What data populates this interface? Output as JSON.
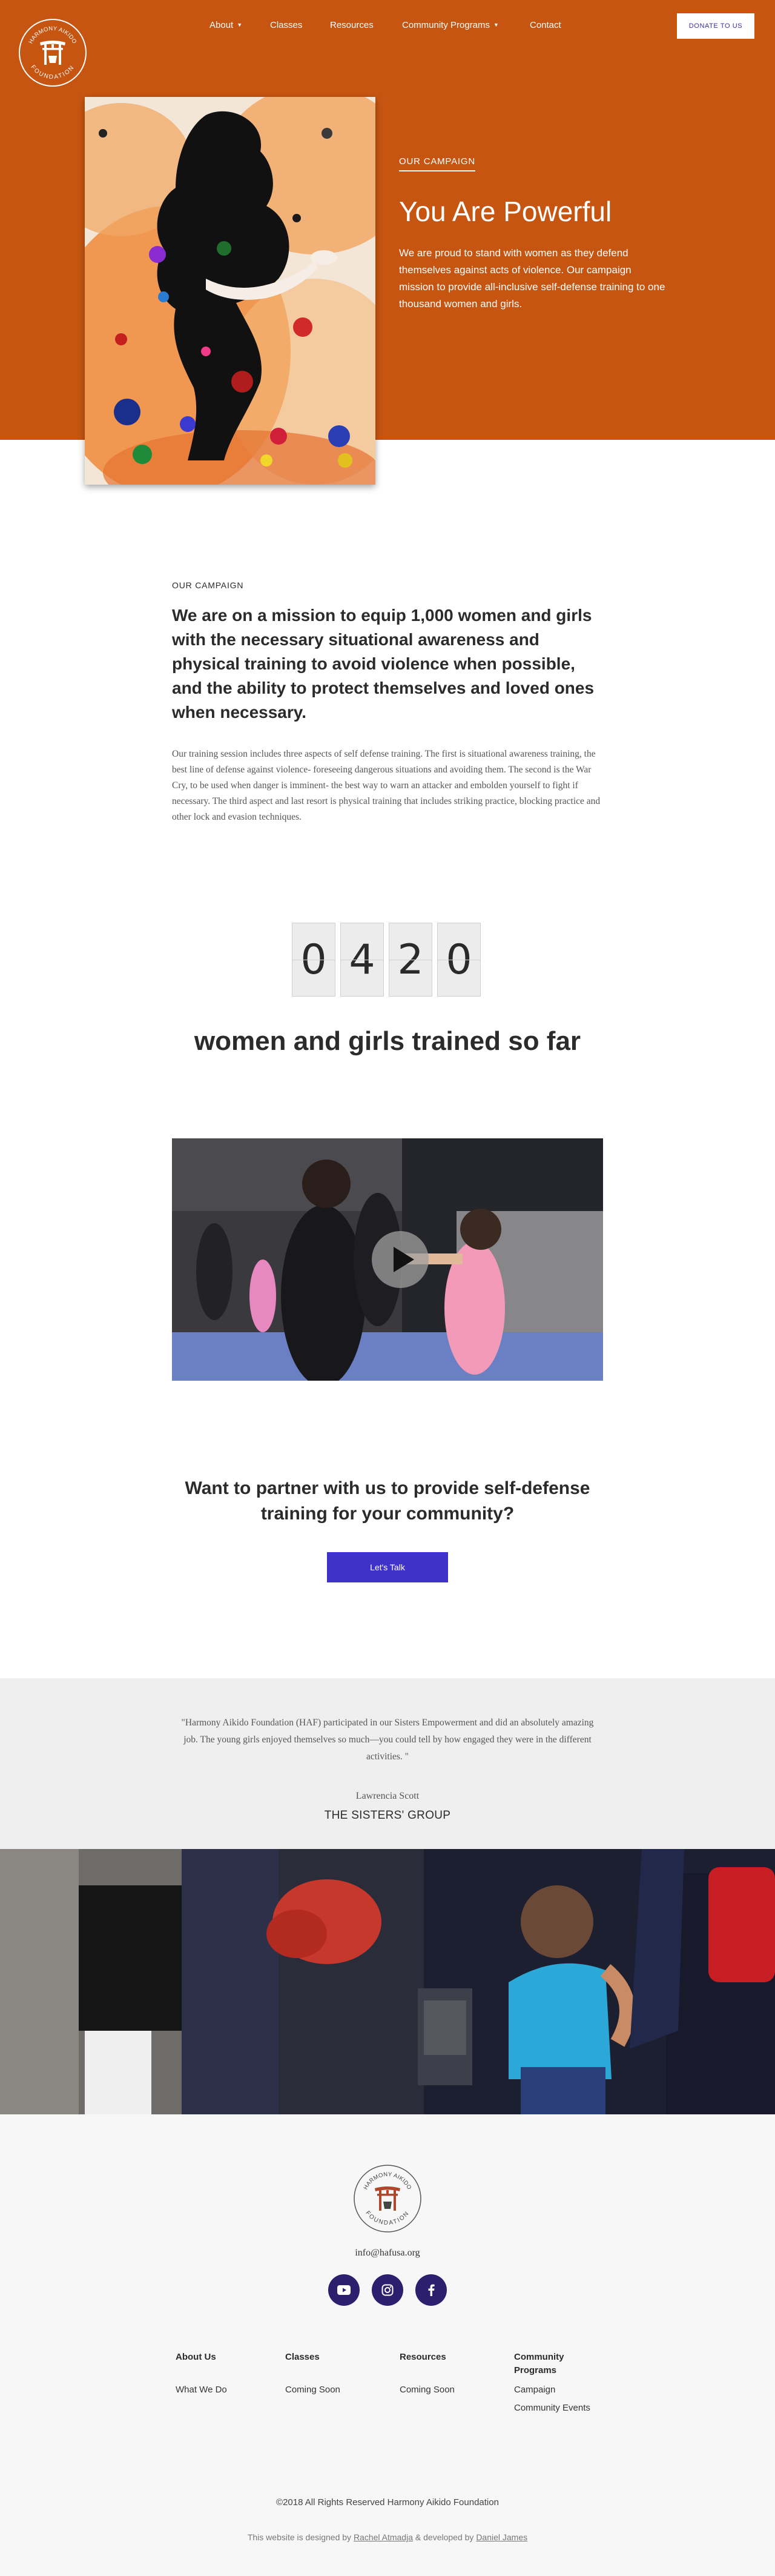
{
  "brand": {
    "logo_text_top": "HARMONY AIKIDO",
    "logo_text_bottom": "FOUNDATION",
    "primary_color": "#c65512",
    "accent_color": "#3f32c9"
  },
  "nav": {
    "items": [
      {
        "label": "About",
        "dropdown": true
      },
      {
        "label": "Classes",
        "dropdown": false
      },
      {
        "label": "Resources",
        "dropdown": false
      },
      {
        "label": "Community Programs",
        "dropdown": true
      },
      {
        "label": "Contact",
        "dropdown": false
      }
    ],
    "donate_label": "DONATE TO US"
  },
  "hero": {
    "eyebrow": "OUR CAMPAIGN",
    "title": "You Are Powerful",
    "text": "We are proud to stand with women as they defend themselves against acts of violence.  Our campaign mission to provide all-inclusive self-defense training to one thousand women and girls."
  },
  "campaign": {
    "eyebrow": "OUR CAMPAIGN",
    "heading": "We are on a mission to equip 1,000 women and girls with the necessary situational awareness and physical training to avoid violence when possible, and the ability to protect themselves and loved ones when necessary.",
    "body": "Our training session includes three aspects of self defense training. The first is situational awareness training, the best line of defense against violence- foreseeing dangerous situations and avoiding them. The second is the War Cry, to be used when danger is imminent- the best way to warn an attacker and embolden yourself to fight if necessary. The third aspect and last resort is physical training that includes striking practice, blocking practice and other lock and evasion techniques."
  },
  "counter": {
    "digits": [
      "0",
      "4",
      "2",
      "0"
    ],
    "label": "women and girls trained so far"
  },
  "video": {
    "play_icon": "play-icon"
  },
  "partner": {
    "question": "Want to partner with us to provide self-defense training for your community?",
    "button_label": "Let's Talk"
  },
  "testimonial": {
    "quote": "\"Harmony Aikido Foundation (HAF) participated in our Sisters Empowerment and did an absolutely amazing job. The young girls enjoyed themselves so much—you could tell by how engaged they were in the different activities. \"",
    "author": "Lawrencia Scott",
    "organization": "THE SISTERS' GROUP"
  },
  "footer": {
    "email": "info@hafusa.org",
    "social": [
      "youtube-icon",
      "instagram-icon",
      "facebook-icon"
    ],
    "columns": [
      {
        "heading": "About Us",
        "links": [
          "What We Do"
        ]
      },
      {
        "heading": "Classes",
        "links": [
          "Coming Soon"
        ]
      },
      {
        "heading": "Resources",
        "links": [
          "Coming Soon"
        ]
      },
      {
        "heading": "Community Programs",
        "links": [
          "Campaign",
          "Community Events"
        ]
      }
    ],
    "copyright": "©2018  All Rights Reserved  Harmony Aikido Foundation",
    "credits_prefix": "This website is designed by",
    "designer": "Rachel Atmadja",
    "credits_mid": "& developed by",
    "developer": "Daniel James"
  }
}
